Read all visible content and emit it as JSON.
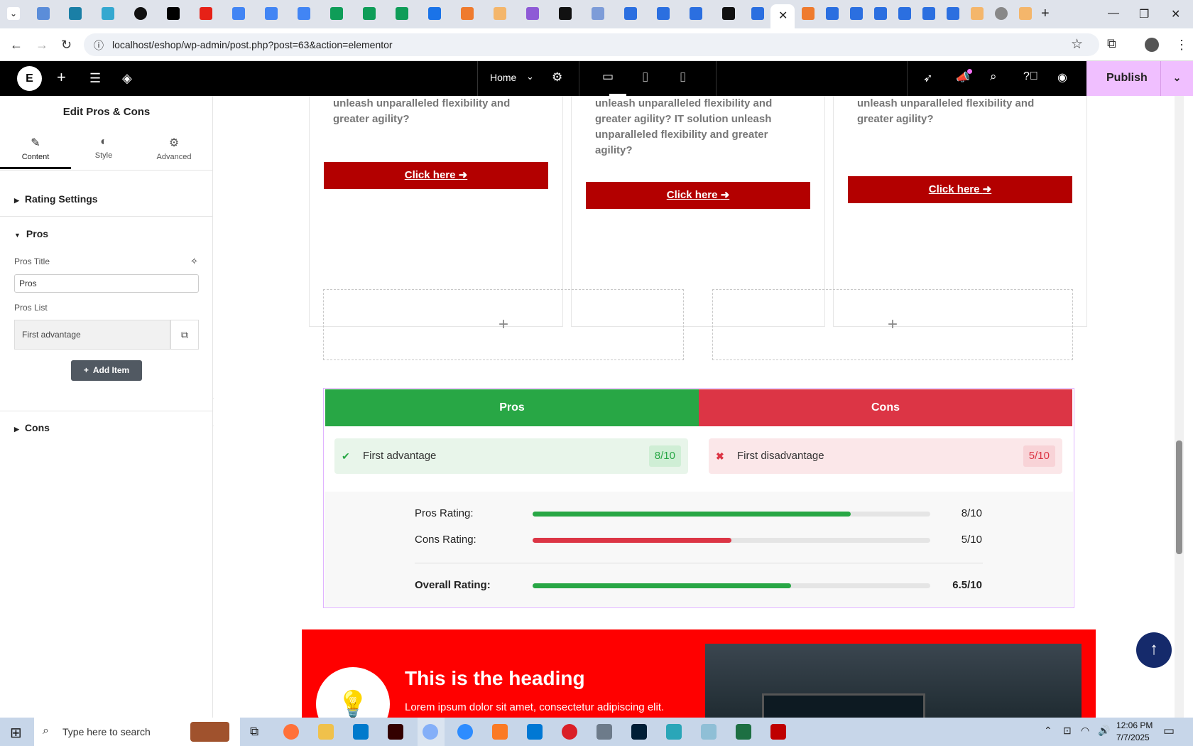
{
  "browser": {
    "url": "localhost/eshop/wp-admin/post.php?post=63&action=elementor"
  },
  "editor": {
    "page_select": "Home",
    "publish_label": "Publish"
  },
  "panel": {
    "title": "Edit Pros & Cons",
    "tabs": [
      {
        "label": "Content",
        "icon": "pencil-icon"
      },
      {
        "label": "Style",
        "icon": "half-circle-icon"
      },
      {
        "label": "Advanced",
        "icon": "gear-icon"
      }
    ],
    "rating_settings": "Rating Settings",
    "pros_section": "Pros",
    "pros_title_label": "Pros Title",
    "pros_title_value": "Pros",
    "pros_list_label": "Pros List",
    "pros_list_item": "First advantage",
    "add_item": "Add Item",
    "cons_section": "Cons"
  },
  "cards": [
    {
      "text": "unleash unparalleled flexibility and greater agility?",
      "button": "Click here"
    },
    {
      "text": "unleash unparalleled flexibility and greater agility? IT solution unleash unparalleled flexibility and greater agility?",
      "button": "Click here"
    },
    {
      "text": "unleash unparalleled flexibility and greater agility?",
      "button": "Click here"
    }
  ],
  "widget": {
    "pros_header": "Pros",
    "cons_header": "Cons",
    "pro_item": {
      "text": "First advantage",
      "score": "8/10"
    },
    "con_item": {
      "text": "First disadvantage",
      "score": "5/10"
    },
    "ratings": [
      {
        "label": "Pros Rating:",
        "value": "8/10",
        "fraction": 0.8,
        "color": "#28a745"
      },
      {
        "label": "Cons Rating:",
        "value": "5/10",
        "fraction": 0.5,
        "color": "#dc3545"
      },
      {
        "label": "Overall Rating:",
        "value": "6.5/10",
        "fraction": 0.65,
        "color": "#28a745"
      }
    ],
    "colors": {
      "pros": "#28a745",
      "cons": "#dc3545"
    }
  },
  "hero": {
    "heading": "This is the heading",
    "text": "Lorem ipsum dolor sit amet, consectetur adipiscing elit."
  },
  "taskbar": {
    "search_placeholder": "Type here to search",
    "time": "12:06 PM",
    "date": "7/7/2025"
  }
}
